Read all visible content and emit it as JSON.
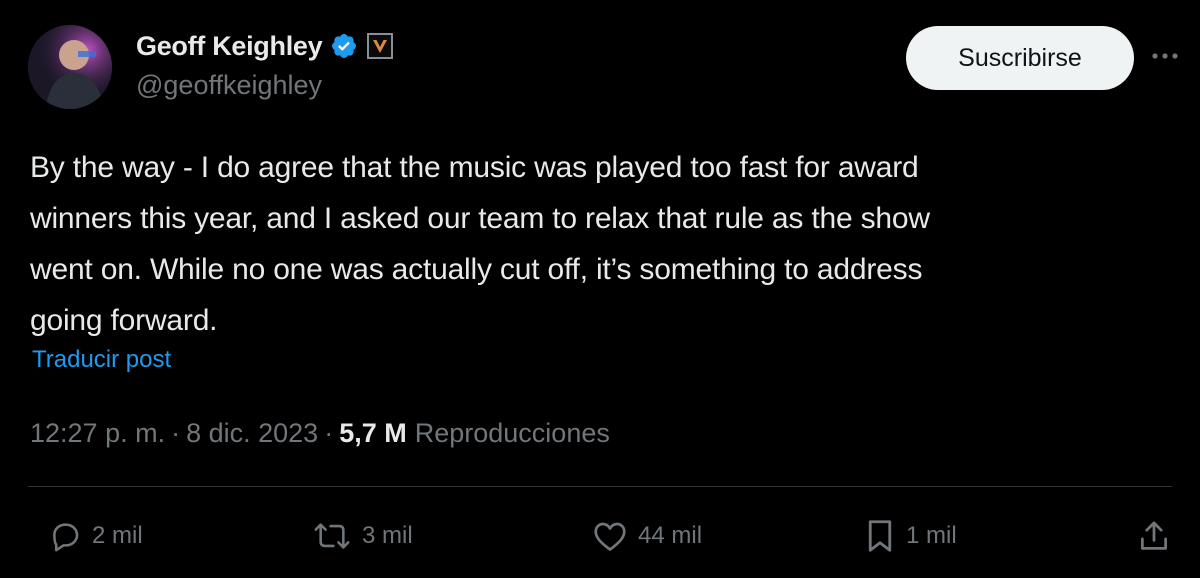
{
  "user": {
    "display_name": "Geoff Keighley",
    "handle": "@geoffkeighley",
    "verified_icon": "verified-badge-icon",
    "affiliate_icon": "affiliate-badge-icon"
  },
  "header": {
    "subscribe_label": "Suscribirse",
    "more_icon": "more-icon"
  },
  "tweet": {
    "text": "By the way - I do agree that the music was played too fast for award\nwinners this year, and I asked our team to relax that rule as the show\nwent on. While no one was actually cut off, it’s something to address\ngoing forward.",
    "translate_label": "Traducir post",
    "time": "12:27 p. m.",
    "date": "8 dic. 2023",
    "separator": "·",
    "views_count": "5,7 M",
    "views_label": "Reproducciones"
  },
  "actions": {
    "reply": {
      "icon": "reply-icon",
      "count": "2 mil"
    },
    "repost": {
      "icon": "repost-icon",
      "count": "3 mil"
    },
    "like": {
      "icon": "like-icon",
      "count": "44 mil"
    },
    "bookmark": {
      "icon": "bookmark-icon",
      "count": "1 mil"
    },
    "share": {
      "icon": "share-icon"
    }
  },
  "colors": {
    "background": "#000000",
    "text_primary": "#e7e9ea",
    "text_secondary": "#71767b",
    "accent": "#1d9bf0",
    "divider": "#2f3336",
    "button_bg": "#eff3f4"
  }
}
